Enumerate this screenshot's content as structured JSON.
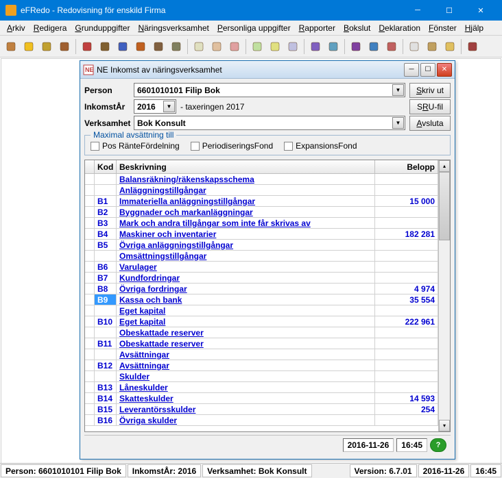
{
  "app": {
    "title": "eFRedo - Redovisning för enskild Firma"
  },
  "menu": [
    "Arkiv",
    "Redigera",
    "Grunduppgifter",
    "Näringsverksamhet",
    "Personliga uppgifter",
    "Rapporter",
    "Bokslut",
    "Deklaration",
    "Fönster",
    "Hjälp"
  ],
  "dialog": {
    "title": "NE Inkomst av näringsverksamhet",
    "labels": {
      "person": "Person",
      "inkomstar": "InkomstÅr",
      "verksamhet": "Verksamhet"
    },
    "person": "6601010101    Filip Bok",
    "year": "2016",
    "tax": "- taxeringen 2017",
    "verksamhet": "Bok Konsult",
    "buttons": {
      "skriv": "Skriv ut",
      "sru": "SRU-fil",
      "avsluta": "Avsluta"
    },
    "fieldset": "Maximal avsättning till",
    "checks": [
      "Pos RänteFördelning",
      "PeriodiseringsFond",
      "ExpansionsFond"
    ],
    "cols": {
      "kod": "Kod",
      "desc": "Beskrivning",
      "amt": "Belopp"
    },
    "rows": [
      {
        "kod": "",
        "desc": "Balansräkning/räkenskapsschema",
        "amt": ""
      },
      {
        "kod": "",
        "desc": "Anläggningstillgångar",
        "amt": ""
      },
      {
        "kod": "B1",
        "desc": "Immateriella anläggningstillgångar",
        "amt": "15 000"
      },
      {
        "kod": "B2",
        "desc": "Byggnader och markanläggningar",
        "amt": ""
      },
      {
        "kod": "B3",
        "desc": "Mark och andra tillgångar som inte får skrivas av",
        "amt": ""
      },
      {
        "kod": "B4",
        "desc": "Maskiner och inventarier",
        "amt": "182 281"
      },
      {
        "kod": "B5",
        "desc": "Övriga anläggningstillgångar",
        "amt": ""
      },
      {
        "kod": "",
        "desc": "Omsättningstillgångar",
        "amt": ""
      },
      {
        "kod": "B6",
        "desc": "Varulager",
        "amt": ""
      },
      {
        "kod": "B7",
        "desc": "Kundfordringar",
        "amt": ""
      },
      {
        "kod": "B8",
        "desc": "Övriga fordringar",
        "amt": "4 974"
      },
      {
        "kod": "B9",
        "desc": "Kassa och bank",
        "amt": "35 554",
        "sel": true
      },
      {
        "kod": "",
        "desc": "Eget kapital",
        "amt": ""
      },
      {
        "kod": "B10",
        "desc": "Eget kapital",
        "amt": "222 961"
      },
      {
        "kod": "",
        "desc": "Obeskattade reserver",
        "amt": ""
      },
      {
        "kod": "B11",
        "desc": "Obeskattade reserver",
        "amt": ""
      },
      {
        "kod": "",
        "desc": "Avsättningar",
        "amt": ""
      },
      {
        "kod": "B12",
        "desc": "Avsättningar",
        "amt": ""
      },
      {
        "kod": "",
        "desc": "Skulder",
        "amt": ""
      },
      {
        "kod": "B13",
        "desc": "Låneskulder",
        "amt": ""
      },
      {
        "kod": "B14",
        "desc": "Skatteskulder",
        "amt": "14 593"
      },
      {
        "kod": "B15",
        "desc": "Leverantörsskulder",
        "amt": "254"
      },
      {
        "kod": "B16",
        "desc": "Övriga skulder",
        "amt": ""
      }
    ],
    "footer": {
      "date": "2016-11-26",
      "time": "16:45"
    }
  },
  "status": {
    "person": "Person: 6601010101  Filip Bok",
    "inkomstar": "InkomstÅr: 2016",
    "verksamhet": "Verksamhet: Bok Konsult",
    "version": "Version: 6.7.01",
    "date": "2016-11-26",
    "time": "16:45"
  },
  "toolbar_icons": [
    "books-icon",
    "bulb-icon",
    "coin-icon",
    "bag-icon",
    "book-red-icon",
    "books2-icon",
    "chart-icon",
    "pencil-icon",
    "brush-icon",
    "tool-icon",
    "form1-icon",
    "form2-icon",
    "form3-icon",
    "doc1-icon",
    "doc2-icon",
    "doc3-icon",
    "cube1-icon",
    "cube2-icon",
    "graph-icon",
    "bars-icon",
    "grid-icon",
    "page-icon",
    "open-icon",
    "note-icon",
    "exit-icon"
  ],
  "toolbar_colors": [
    "#c08040",
    "#f0c020",
    "#c0a030",
    "#a06030",
    "#c04040",
    "#806030",
    "#4060c0",
    "#c06020",
    "#806040",
    "#808060",
    "#e0e0c0",
    "#e0c0a0",
    "#e0a0a0",
    "#c0e0a0",
    "#e0e080",
    "#c0c0e0",
    "#8060c0",
    "#60a0c0",
    "#8040a0",
    "#4080c0",
    "#c06060",
    "#e0e0e0",
    "#c0a060",
    "#e0c060",
    "#a04040"
  ]
}
